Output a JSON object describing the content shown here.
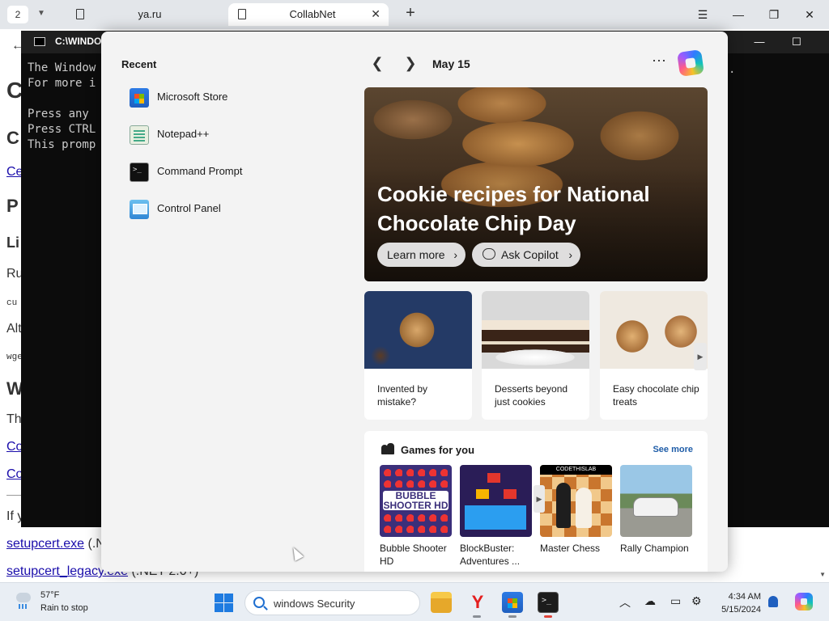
{
  "browser": {
    "tab_count": "2",
    "tabs": [
      {
        "title": "ya.ru"
      },
      {
        "title": "CollabNet",
        "close": "✕"
      }
    ],
    "new_tab": "+",
    "controls": {
      "menu": "☰",
      "minimize": "—",
      "restore": "❐",
      "close": "✕"
    }
  },
  "page": {
    "back": "←",
    "lines": [
      {
        "text": "C",
        "kind": "h1"
      },
      {
        "text": "C",
        "kind": "h2"
      },
      {
        "text": "Ce",
        "kind": "link"
      },
      {
        "text": "P",
        "kind": "h2"
      },
      {
        "text": "Li",
        "kind": "h3"
      },
      {
        "text": "Ru",
        "kind": "text"
      },
      {
        "text": "cu",
        "kind": "code"
      },
      {
        "text": "Alt",
        "kind": "text"
      },
      {
        "text": "wge",
        "kind": "code"
      },
      {
        "text": "W",
        "kind": "h2"
      },
      {
        "text": "Th",
        "kind": "text"
      },
      {
        "text": "Co",
        "kind": "link"
      },
      {
        "text": "Co",
        "kind": "link"
      },
      {
        "text": "If y",
        "kind": "text"
      },
      {
        "text": "setupcert.exe",
        "suffix": " (.N",
        "kind": "link"
      },
      {
        "text": "setupcert_legacy.exe",
        "suffix": " (.NET 2.0+)",
        "kind": "link"
      }
    ]
  },
  "console": {
    "title": "C:\\WINDO",
    "lines": [
      "The Window",
      "For more i",
      "",
      "Press any",
      "Press CTRL",
      "This promp"
    ],
    "trailing": ".",
    "controls": {
      "minimize": "—",
      "maximize": "☐"
    }
  },
  "start_panel": {
    "recent_title": "Recent",
    "recent_items": [
      {
        "label": "Microsoft Store",
        "icon": "microsoft-store-icon"
      },
      {
        "label": "Notepad++",
        "icon": "notepad-plus-plus-icon"
      },
      {
        "label": "Command Prompt",
        "icon": "command-prompt-icon"
      },
      {
        "label": "Control Panel",
        "icon": "control-panel-icon"
      }
    ],
    "nav": {
      "prev": "❮",
      "next": "❯",
      "date": "May 15",
      "more": "⋯"
    },
    "hero": {
      "title": "Cookie recipes for National Chocolate Chip Day",
      "learn_more": "Learn more",
      "ask_copilot": "Ask Copilot",
      "chevron": "›"
    },
    "cards": [
      {
        "title": "Invented by mistake?"
      },
      {
        "title": "Desserts beyond just cookies"
      },
      {
        "title": "Easy chocolate chip treats"
      }
    ],
    "card_next": "▶",
    "games": {
      "title": "Games for you",
      "see_more": "See more",
      "items": [
        {
          "name": "Bubble Shooter HD",
          "art": "BUBBLE SHOOTER HD"
        },
        {
          "name": "BlockBuster: Adventures ..."
        },
        {
          "name": "Master Chess",
          "art": "CODETHISLAB"
        },
        {
          "name": "Rally Champion"
        }
      ],
      "next": "▶"
    }
  },
  "taskbar": {
    "weather": {
      "temp": "57°F",
      "condition": "Rain to stop"
    },
    "search": {
      "query": "windows Security"
    },
    "apps": [
      "file-explorer",
      "yandex-browser",
      "microsoft-store",
      "terminal"
    ],
    "yandex_glyph": "Y",
    "tray": {
      "chevron": "︿",
      "time": "4:34 AM",
      "date": "5/15/2024"
    },
    "colors": {
      "accent": "#1f7be0",
      "indicator": "#8a8f96",
      "active_indicator": "#e0443a"
    }
  }
}
